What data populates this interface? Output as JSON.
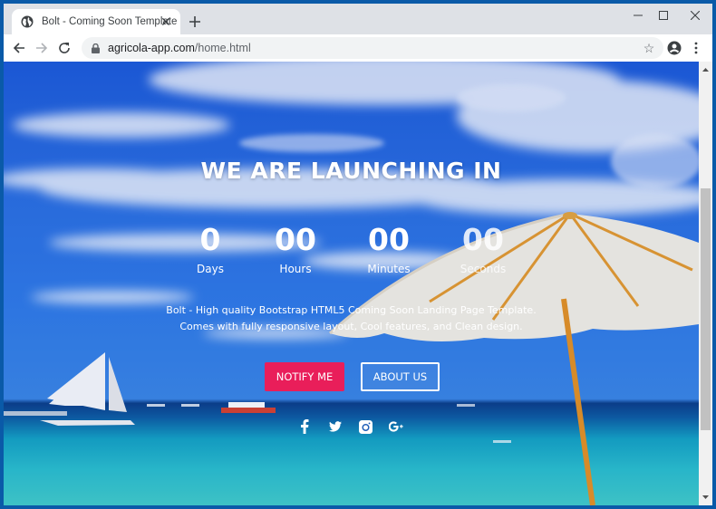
{
  "browser": {
    "tab_title": "Bolt - Coming Soon Template",
    "url_domain": "agricola-app.com",
    "url_path": "/home.html",
    "icons": {
      "tab_favicon": "globe-icon",
      "tab_close": "close-icon",
      "new_tab": "plus-icon",
      "minimize": "minimize-icon",
      "maximize": "maximize-icon",
      "close_window": "close-icon",
      "back": "arrow-left-icon",
      "forward": "arrow-right-icon",
      "reload": "reload-icon",
      "secure": "lock-icon",
      "bookmark": "star-icon",
      "profile": "account-icon",
      "menu": "kebab-menu-icon"
    }
  },
  "page": {
    "headline": "WE ARE LAUNCHING IN",
    "countdown": [
      {
        "value": "0",
        "label": "Days"
      },
      {
        "value": "00",
        "label": "Hours"
      },
      {
        "value": "00",
        "label": "Minutes"
      },
      {
        "value": "00",
        "label": "Seconds"
      }
    ],
    "description_line1": "Bolt - High quality Bootstrap HTML5 Coming Soon Landing Page Template.",
    "description_line2": "Comes with fully responsive layout, Cool features, and Clean design.",
    "notify_label": "NOTIFY ME",
    "about_label": "ABOUT US",
    "social": [
      "facebook-icon",
      "twitter-icon",
      "instagram-icon",
      "google-plus-icon"
    ],
    "colors": {
      "notify_button": "#e91e5a",
      "window_frame": "#0a5aa8"
    }
  }
}
